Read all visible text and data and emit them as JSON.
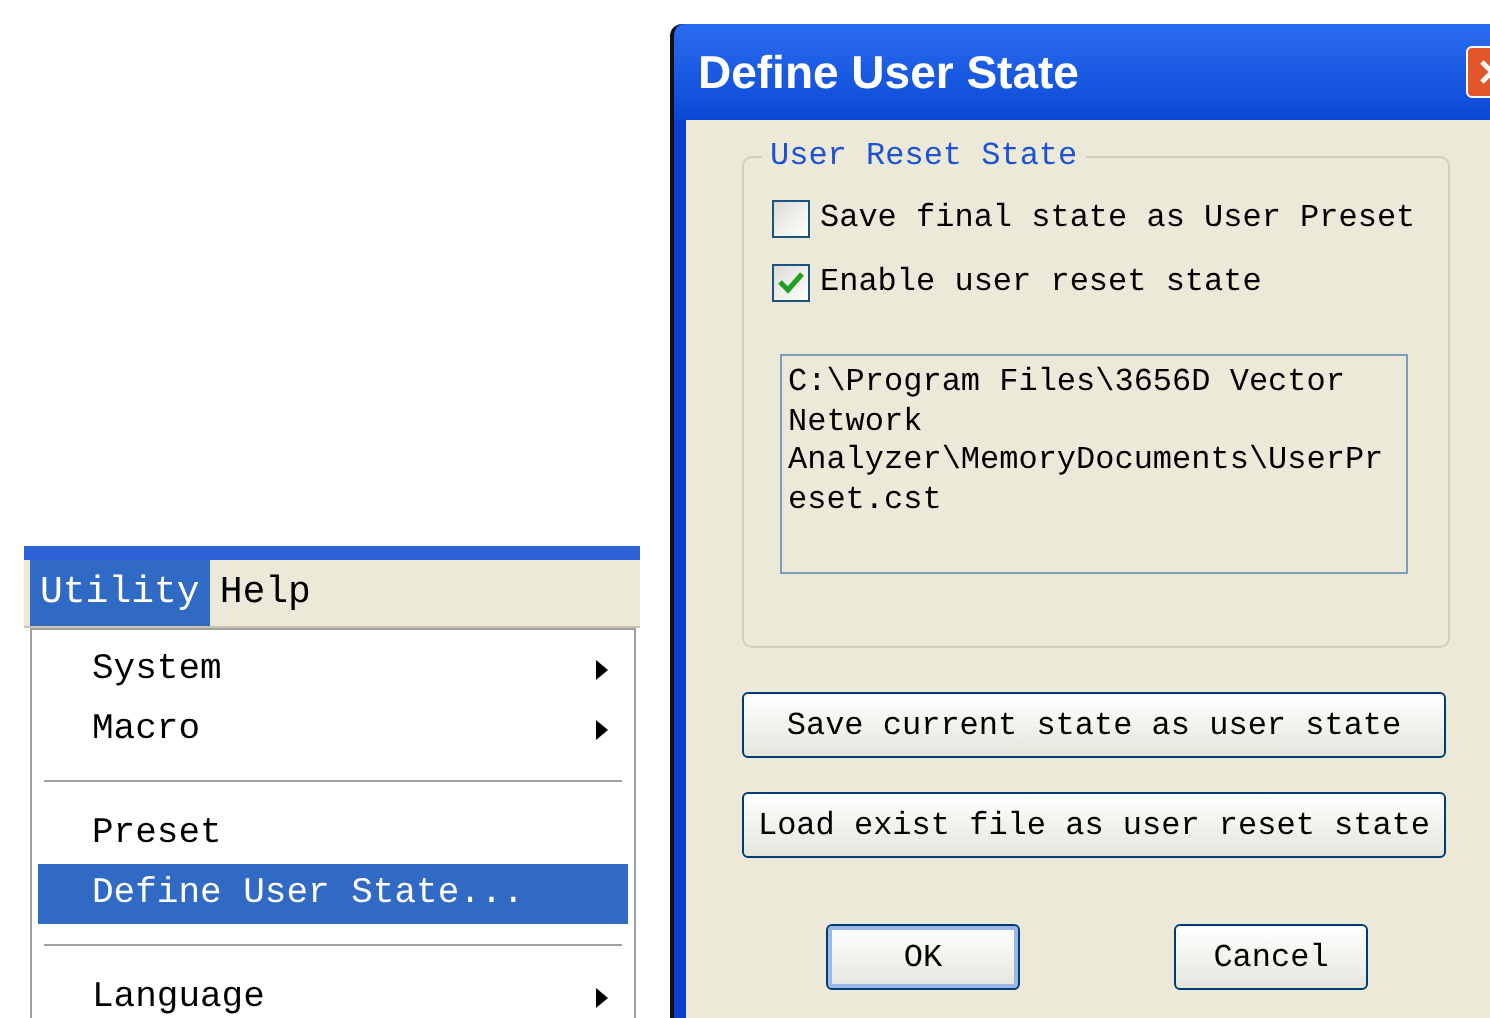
{
  "menu_bar": {
    "items": [
      {
        "label": "Utility",
        "selected": true
      },
      {
        "label": "Help",
        "selected": false
      }
    ]
  },
  "menu": {
    "items": [
      {
        "kind": "item",
        "label": "System",
        "submenu": true,
        "selected": false
      },
      {
        "kind": "item",
        "label": "Macro",
        "submenu": true,
        "selected": false
      },
      {
        "kind": "separator"
      },
      {
        "kind": "item",
        "label": "Preset",
        "submenu": false,
        "selected": false
      },
      {
        "kind": "item",
        "label": "Define User State...",
        "submenu": false,
        "selected": true
      },
      {
        "kind": "separator"
      },
      {
        "kind": "item",
        "label": "Language",
        "submenu": true,
        "selected": false
      }
    ]
  },
  "dialog": {
    "title": "Define User State",
    "group": {
      "legend": "User Reset State",
      "checkboxes": [
        {
          "label": "Save final state as User Preset",
          "checked": false
        },
        {
          "label": "Enable user reset state",
          "checked": true
        }
      ],
      "path_box": {
        "value": "C:\\Program Files\\3656D Vector Network Analyzer\\MemoryDocuments\\UserPreset.cst"
      }
    },
    "action_buttons": [
      "Save current state as user state",
      "Load exist file as user reset state"
    ],
    "footer_buttons": [
      {
        "label": "OK",
        "default": true
      },
      {
        "label": "Cancel",
        "default": false
      }
    ]
  }
}
